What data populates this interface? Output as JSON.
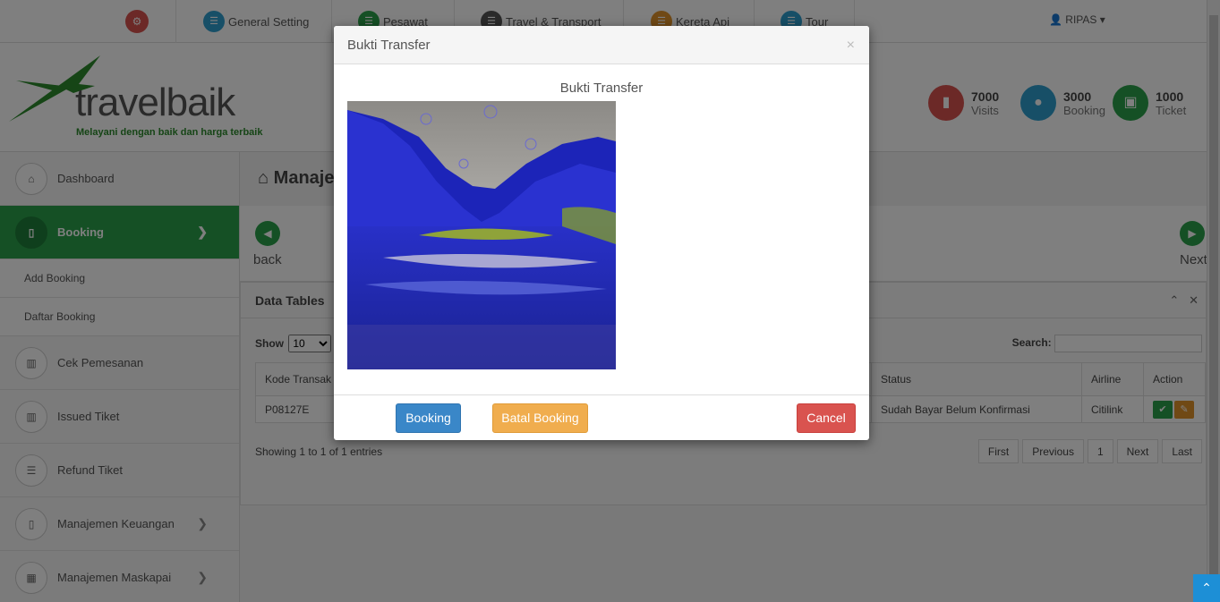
{
  "topnav": {
    "items": [
      {
        "label": "General Setting",
        "icon": "bank-icon",
        "color": "#2e9fcf"
      },
      {
        "label": "Pesawat",
        "icon": "bank-icon",
        "color": "#2aa14a"
      },
      {
        "label": "Travel & Transport",
        "icon": "bank-icon",
        "color": "#555555"
      },
      {
        "label": "Kereta Api",
        "icon": "bank-icon",
        "color": "#e0922b"
      },
      {
        "label": "Tour",
        "icon": "bank-icon",
        "color": "#2e9fcf"
      }
    ],
    "user": "RIPAS"
  },
  "logo": {
    "brand": "travelbaik",
    "tagline": "Melayani dengan baik dan harga terbaik"
  },
  "stats": [
    {
      "value": "7000",
      "label": "Visits",
      "color": "#d9534f"
    },
    {
      "value": "3000",
      "label": "Booking",
      "color": "#2e9fcf"
    },
    {
      "value": "1000",
      "label": "Ticket",
      "color": "#2aa14a"
    }
  ],
  "sidebar": {
    "dashboard": "Dashboard",
    "booking": "Booking",
    "add_booking": "Add Booking",
    "daftar_booking": "Daftar Booking",
    "cek_pemesanan": "Cek Pemesanan",
    "issued_tiket": "Issued Tiket",
    "refund_tiket": "Refund Tiket",
    "manajemen_keuangan": "Manajemen Keuangan",
    "manajemen_maskapai": "Manajemen Maskapai"
  },
  "main": {
    "page_title": "Manaje",
    "back_label": "back",
    "next_label": "Next",
    "panel_title": "Data Tables",
    "show_label": "Show",
    "show_value": "10",
    "search_label": "Search:",
    "columns": {
      "kode": "Kode Transak",
      "status": "Status",
      "airline": "Airline",
      "action": "Action"
    },
    "rows": [
      {
        "kode": "P08127E",
        "status": "Sudah Bayar Belum Konfirmasi",
        "airline": "Citilink"
      }
    ],
    "info": "Showing 1 to 1 of 1 entries",
    "pagination": {
      "first": "First",
      "previous": "Previous",
      "page": "1",
      "next": "Next",
      "last": "Last"
    }
  },
  "modal": {
    "title": "Bukti Transfer",
    "close": "×",
    "image_caption": "Bukti Transfer",
    "buttons": {
      "booking": "Booking",
      "batal": "Batal Booking",
      "cancel": "Cancel"
    },
    "colors": {
      "booking": "#3a87c8",
      "batal": "#f0ad4e",
      "cancel": "#d9534f"
    }
  }
}
